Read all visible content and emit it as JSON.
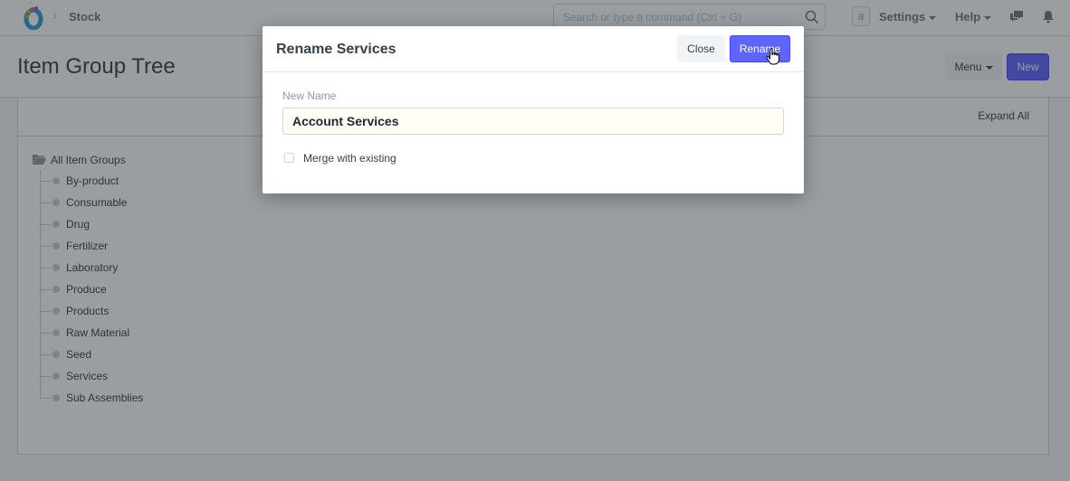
{
  "navbar": {
    "logo_icon": "app-logo",
    "breadcrumb": "Stock",
    "search_placeholder": "Search or type a command (Ctrl + G)",
    "avatar_initial": "a",
    "settings_label": "Settings",
    "help_label": "Help",
    "icons": [
      "chevron-right-icon",
      "search-icon",
      "chat-icon",
      "bell-icon"
    ]
  },
  "page": {
    "title": "Item Group Tree",
    "menu_label": "Menu",
    "new_label": "New",
    "accent_color": "#5e64ff"
  },
  "tree": {
    "expand_all_label": "Expand All",
    "root": "All Item Groups",
    "children": [
      "By-product",
      "Consumable",
      "Drug",
      "Fertilizer",
      "Laboratory",
      "Produce",
      "Products",
      "Raw Material",
      "Seed",
      "Services",
      "Sub Assemblies"
    ]
  },
  "modal": {
    "title": "Rename Services",
    "close_label": "Close",
    "rename_label": "Rename",
    "field_label": "New Name",
    "field_value": "Account Services",
    "merge_label": "Merge with existing",
    "merge_checked": false
  }
}
